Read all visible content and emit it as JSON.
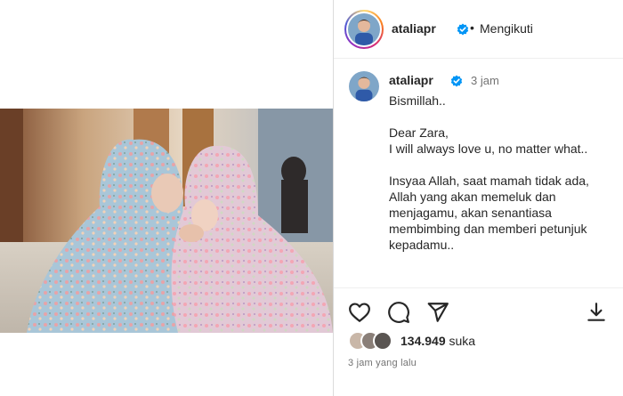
{
  "header": {
    "username": "ataliapr",
    "separator": "•",
    "follow_status": "Mengikuti"
  },
  "caption": {
    "username": "ataliapr",
    "time": "3 jam",
    "lines": {
      "l1": "Bismillah..",
      "l2": "Dear Zara,",
      "l3": "I will always love u, no matter what..",
      "l4": "Insyaa Allah, saat mamah tidak ada, Allah yang akan memeluk dan menjagamu, akan senantiasa membimbing dan memberi petunjuk kepadamu.."
    }
  },
  "actions": {
    "like_icon": "heart-icon",
    "comment_icon": "comment-icon",
    "share_icon": "share-icon",
    "save_icon": "download-icon"
  },
  "likes": {
    "count": "134.949",
    "label": "suka"
  },
  "posted": "3 jam yang lalu",
  "colors": {
    "verified": "#0095f6",
    "text": "#262626",
    "muted": "#737373",
    "divider": "#dbdbdb"
  }
}
